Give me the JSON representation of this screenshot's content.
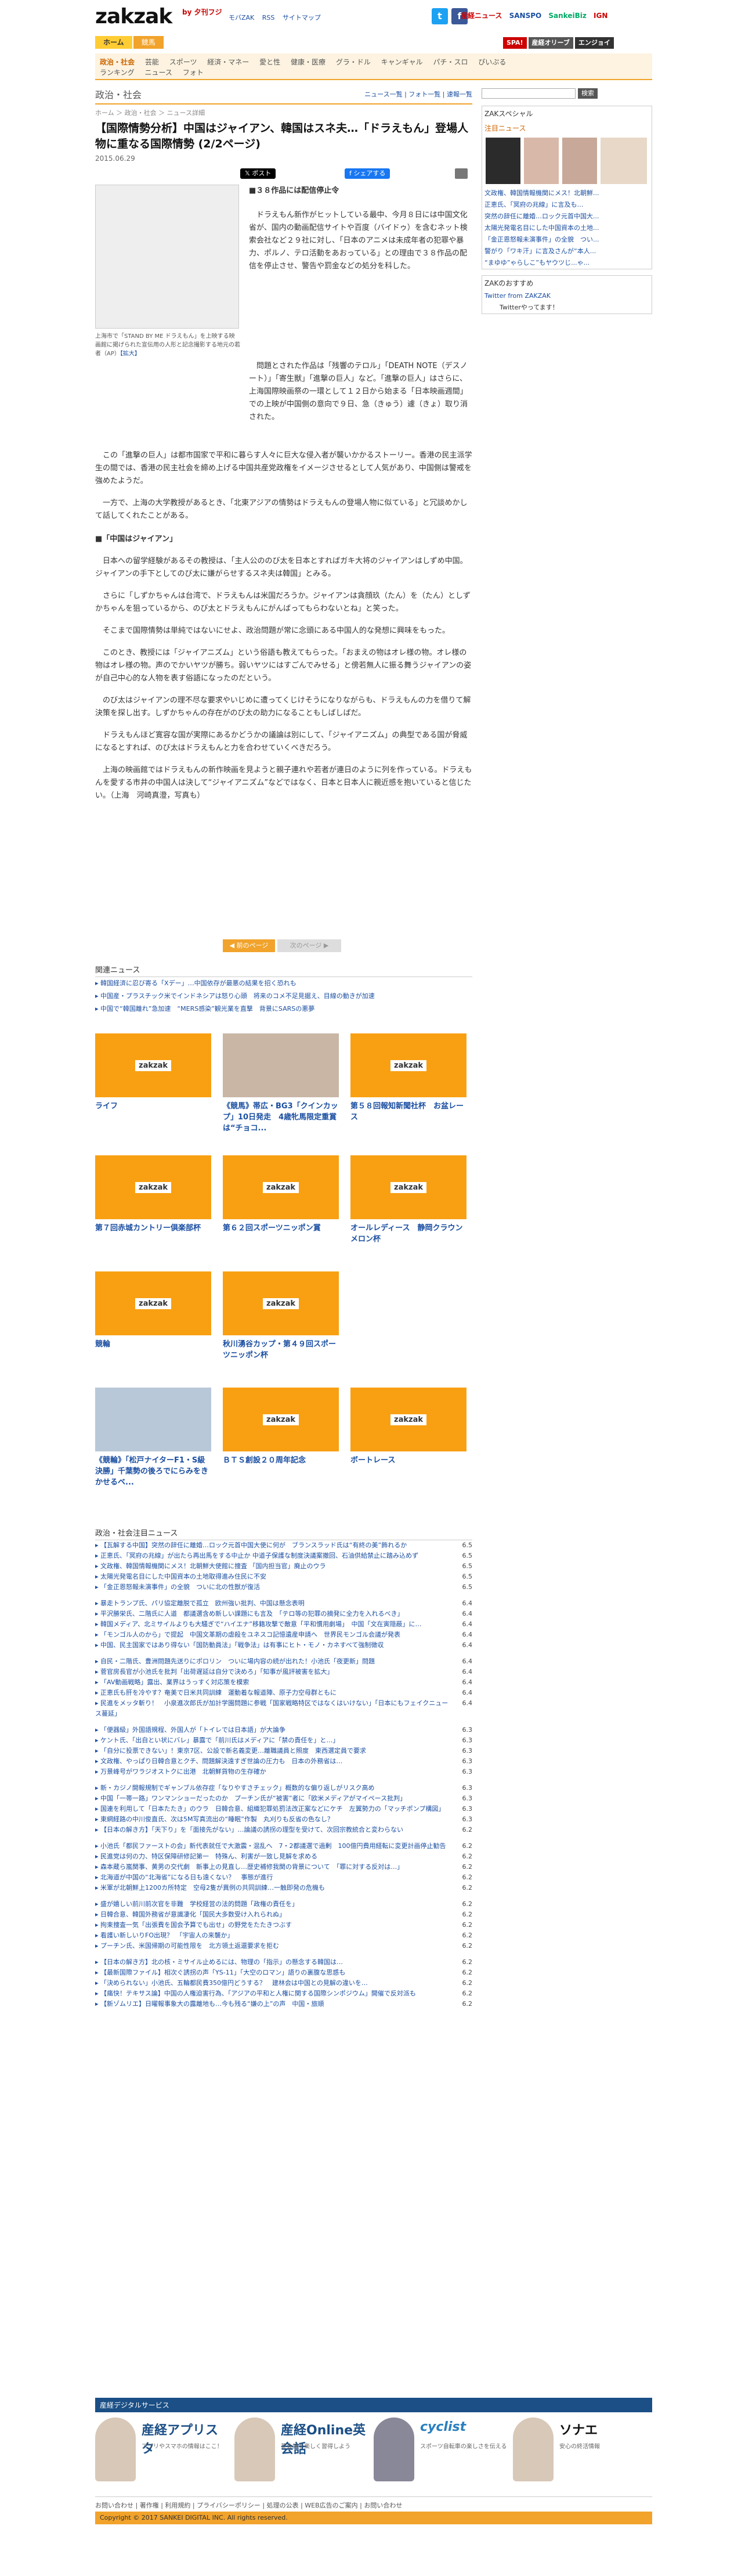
{
  "header": {
    "logo_main": "zakzak",
    "logo_by": "by",
    "logo_sub": "夕刊フジ",
    "links": [
      "モバZAK",
      "RSS",
      "サイトマップ"
    ],
    "sns": [
      "t",
      "f"
    ],
    "brands": [
      "産経ニュース",
      "SANSPO",
      "SankeiBiz",
      "IGN"
    ],
    "tabs": [
      "ホーム",
      "競馬"
    ],
    "ads": [
      "SPA!",
      "産経オリーブ",
      "エンジョイ"
    ]
  },
  "nav": {
    "row1": [
      "政治・社会",
      "芸能",
      "スポーツ",
      "経済・マネー",
      "愛と性",
      "健康・医療",
      "グラ・ドル",
      "キャンギャル",
      "パチ・スロ",
      "ぴいぷる"
    ],
    "row2": [
      "ランキング",
      "ニュース",
      "フォト"
    ]
  },
  "article": {
    "section": "政治・社会",
    "section_links": "ニュース一覧 | フォト一覧 | 速報一覧",
    "crumb": "ホーム ＞ 政治・社会 ＞ ニュース詳細",
    "title": "【国際情勢分析】中国はジャイアン、韓国はスネ夫…「ドラえもん」登場人物に重なる国際情勢 (2/2ページ)",
    "date": "2015.06.29",
    "share_tw": "ポスト",
    "share_fb": "シェアする",
    "photo_caption": "上海市で「STAND BY ME ドラえもん」を上映する映画館に掲げられた宣伝用の人形と記念撮影する地元の若者（AP）",
    "photo_caption_link": "【拡大】",
    "lead": "■３８作品には配信停止令",
    "paragraphs": [
      "ドラえもん新作がヒットしている最中、今月８日には中国文化省が、国内の動画配信サイトや百度（バイドゥ）を含むネット検索会社など２９社に対し、「日本のアニメは未成年者の犯罪や暴力、ポルノ、テロ活動をあおっている」との理由で３８作品の配信を停止させ、警告や罰金などの処分を科した。",
      "問題とされた作品は「残響のテロル」「DEATH NOTE（デスノート）」「寄生獣」「進撃の巨人」など。「進撃の巨人」はさらに、上海国際映画祭の一環として１２日から始まる「日本映画週間」での上映が中国側の意向で９日、急（きゅう）遽（きょ）取り消された。",
      "この「進撃の巨人」は都市国家で平和に暮らす人々に巨大な侵入者が襲いかかるストーリー。香港の民主派学生の間では、香港の民主社会を締め上げる中国共産党政権をイメージさせるとして人気があり、中国側は警戒を強めたようだ。",
      "一方で、上海の大学教授があるとき、「北東アジアの情勢はドラえもんの登場人物に似ている」と冗談めかして話してくれたことがある。",
      "■「中国はジャイアン」",
      "日本への留学経験があるその教授は、「主人公ののび太を日本とすればガキ大将のジャイアンはしずめ中国。ジャイアンの手下としてのび太に嫌がらせするスネ夫は韓国」とみる。",
      "さらに「しずかちゃんは台湾で、ドラえもんは米国だろうか。ジャイアンは貪顔玖（たん）を（たん）としずかちゃんを狙っているから、のび太とドラえもんにがんばってもらわないとね」と笑った。",
      "そこまで国際情勢は単純ではないにせよ、政治問題が常に念頭にある中国人的な発想に興味をもった。",
      "このとき、教授には「ジャイアニズム」という俗語も教えてもらった。「おまえの物はオレ様の物。オレ様の物はオレ様の物。声のでかいヤツが勝ち。弱いヤツにはすごんでみせる」と傍若無人に振る舞うジャイアンの姿が自己中心的な人物を表す俗語になったのだという。",
      "のび太はジャイアンの理不尽な要求やいじめに遭ってくじけそうになりながらも、ドラえもんの力を借りて解決策を探し出す。しずかちゃんの存在がのび太の助力になることもしばしばだ。",
      "ドラえもんほど寛容な国が実際にあるかどうかの議論は別にして、「ジャイアニズム」の典型である国が脅威になるとすれば、のび太はドラえもんと力を合わせていくべきだろう。",
      "上海の映画館ではドラえもんの新作映画を見ようと親子連れや若者が連日のように列を作っている。ドラえもんを愛する市井の中国人は決して“ジャイアニズム”などではなく、日本と日本人に親近感を抱いていると信じたい。（上海　河崎真澄，写真も）"
    ],
    "pager_prev": "前のページ",
    "pager_next": "次のページ"
  },
  "related": {
    "head": "関連ニュース",
    "items": [
      "韓国経済に忍び寄る「Xデー」…中国依存が最悪の結果を招く恐れも",
      "中国産・プラスチック米でインドネシアは怒り心頭　将来のコメ不足見据え、目線の動きが加速",
      "中国で“韓国離れ”急加速　“MERS感染”観光業を直撃　背景にSARSの悪夢"
    ]
  },
  "tiles": [
    {
      "caption": "ライフ",
      "photo": false
    },
    {
      "caption": "《競馬》帯広・BG3「クインカップ」10日発走　4歳牝馬限定重賞は“チョコ...",
      "photo": true
    },
    {
      "caption": "第５８回報知新聞社杯　お盆レース",
      "photo": false
    },
    {
      "caption": "第７回赤城カントリー倶楽部杯",
      "photo": false
    },
    {
      "caption": "第６２回スポーツニッポン賞",
      "photo": false
    },
    {
      "caption": "オールレディース　静岡クラウンメロン杯",
      "photo": false
    },
    {
      "caption": "競輪",
      "photo": false
    },
    {
      "caption": "秋川湧谷カップ・第４９回スポーツニッポン杯",
      "photo": false
    },
    {
      "caption": "《競輪》「松戸ナイターF1・S級決勝」千葉勢の後ろでにらみをきかせるベ...",
      "photo": true
    },
    {
      "caption": "ＢＴＳ創設２０周年記念",
      "photo": false
    },
    {
      "caption": "ボートレース",
      "photo": false
    }
  ],
  "tile_logo": "zakzak",
  "ranking": {
    "head": "政治・社会注目ニュース",
    "groups": [
      [
        {
          "t": "【瓦解する中国】突然の辞任に離婚…ロック元首中国大使に何が　ブランスラッド氏は“有終の美”飾れるか",
          "n": "6.5"
        },
        {
          "t": "正恵氏、「冥府の兆線」が出たら再出馬をする中止か 中道子保護な制度決議案撤回、石油供給禁止に踏み込めず",
          "n": "6.5"
        },
        {
          "t": "文政権、韓国情報機関にメス！北朝鮮大使館に捜査 「国内担当官」廃止のウラ",
          "n": "6.5"
        },
        {
          "t": "太陽光発電名目にした中国資本の土地取得進み住民に不安",
          "n": "6.5"
        },
        {
          "t": "「金正恩怒報未演事件」の全貌　ついに北の性獣が復活",
          "n": "6.5"
        }
      ],
      [
        {
          "t": "暴走トランプ氏、パリ協定離脱で孤立　欧州強い批判、中国は懸念表明",
          "n": "6.4"
        },
        {
          "t": "平沢勝栄氏、二階氏に人道　都議選含め新しい課題にも言及　「テロ等の犯罪の摘発に全力を入れるべき」",
          "n": "6.4"
        },
        {
          "t": "韓国メディア、北ミサイルよりも大騒ぎで“ハイエナ”移籍攻撃で敵意「平和慣用劇場」　中国「文在寅隠蔽」に…",
          "n": "6.4"
        },
        {
          "t": "「モンゴル人のから」で提起　中国文革期の虐殺をユネスコ記憶遺産申請へ　世界民モンゴル会議が発表",
          "n": "6.4"
        },
        {
          "t": "中国、民主国家ではあり得ない「国防動員法」「戦争法」は有事にヒト・モノ・カネすべて強制徴収",
          "n": "6.4"
        }
      ],
      [
        {
          "t": "自民・二階氏、豊洲問題先送りにポロリン　ついに場内容の続が出れた！小池氏「夜更新」問題",
          "n": "6.4"
        },
        {
          "t": "菅官房長官が小池氏を批判「出荷遅延は自分で決めろ」「知事が風評被害を拡大」",
          "n": "6.4"
        },
        {
          "t": "「AV動画戦略」露出、業界はうっすく対応策を模索",
          "n": "6.4"
        },
        {
          "t": "正恵氏も肝を冷やす？奄美で日米共同訓練　運動着な報道陣、原子力空母群ともに",
          "n": "6.4"
        },
        {
          "t": "民進をメッタ斬り！　小泉進次郎氏が加計学園問題に参戦「国家戦略特区ではなくはいけない」「日本にもフェイクニュース蔓延」",
          "n": "6.4"
        }
      ],
      [
        {
          "t": "「便器級」外国語規程、外国人が「トイレでは日本語」が大論争",
          "n": "6.3"
        },
        {
          "t": "ケント氏、「出自とい状にバレ」暴露で「前川氏はメディアに「禁の責任を」と…」",
          "n": "6.3"
        },
        {
          "t": "「自分に投票できない」！東京7区、公設で新名義変更…離職議員と照度　東西選定員で要求",
          "n": "6.3"
        },
        {
          "t": "文政権、やっぱり日韓合意とクチ、問題解決遠すぎ世論の圧力も　日本の外務省は…",
          "n": "6.3"
        },
        {
          "t": "万景峰号がワラジオストクに出港　北朝鮮貨物の生存確か",
          "n": "6.3"
        }
      ],
      [
        {
          "t": "新・カジノ開報規制でギャンブル依存症「なりやすさチェック」概数的な偏り返しがリスク高め",
          "n": "6.3"
        },
        {
          "t": "中国「一帯一路」ワンマンショーだったのか　プーチン氏が“被害”者に「欧米メディアがマイペース批判」",
          "n": "6.3"
        },
        {
          "t": "国連を利用して「日本たたき」のウラ　日韓合意、組織犯罪処罰法改正案などにケチ　左翼勢力の「マッチポンプ構図」",
          "n": "6.3"
        },
        {
          "t": "東網経路の中川俊直氏、次は5M写真流出の“睡眠”作製　丸刈りも反省の色なし？",
          "n": "6.3"
        },
        {
          "t": "【日本の解き方】「天下り」を「面接先がない」…論議の誘拐の理型を受けて、次回宗教統合と変わらない",
          "n": "6.2"
        }
      ],
      [
        {
          "t": "小池氏「都民ファーストの会」新代表就任で大激震・混乱へ　7・2都議選で過剰　100億円費用経転に変更計画停止勧告",
          "n": "6.2"
        },
        {
          "t": "民進党は何の力、特区保障研修記第一　特殊ん、利害が一致し見解を求める",
          "n": "6.2"
        },
        {
          "t": "森本蔵ら嵐関事、黄男の交代劇　新事上の見直し…歴史補修我関の背景について　「罪に対する反対は…」",
          "n": "6.2"
        },
        {
          "t": "北海道が中国の“北海省”になる日も遠くない？　事態が進行",
          "n": "6.2"
        },
        {
          "t": "米軍が北朝鮮上1200カ所特定　空母2隻が異例の共同訓練…一触即発の危機も",
          "n": "6.2"
        }
      ],
      [
        {
          "t": "盛が嬉しい前川前次官を非難　学校経営の法的問題「政権の責任を」",
          "n": "6.2"
        },
        {
          "t": "日韓合意、韓国外務省が意識凄化「国民大多数受け入れられぬ」",
          "n": "6.2"
        },
        {
          "t": "拘束捜査一気「出張費を国会予算でも出せ」の野党をたたきつぶす",
          "n": "6.2"
        },
        {
          "t": "看護い新しいりFO出現？　「宇宙人の来襲か」",
          "n": "6.2"
        },
        {
          "t": "プーチン氏、米国帰期の可能性限を　北方領土返還要求を拒む",
          "n": "6.2"
        }
      ],
      [
        {
          "t": "【日本の解き方】北の核・ミサイル止めるには、物理の「指示」の懸念する韓国は…",
          "n": "6.2"
        },
        {
          "t": "【最新国際ファイル】相次ぐ誘拐の声「YS-11」「大空のロマン」語りの裏腹な思惑も",
          "n": "6.2"
        },
        {
          "t": "「決められない」小池氏、五輪都民費350億円どうする？　建林会は中国との見解の違いを…",
          "n": "6.2"
        },
        {
          "t": "【痛快！テキサス論】中国の人権迫害行為、「アジアの平和と人権に関する国際シンポジウム」開催で反対派も",
          "n": "6.2"
        },
        {
          "t": "【新ゾムリエ】日曜報事象大の露離地も…今も残る“嫌の上”の声　中国・旅順",
          "n": "6.2"
        }
      ]
    ]
  },
  "rightcol": {
    "search_btn": "検索",
    "special_head": "ZAKスペシャル",
    "news_head": "注目ニュース",
    "news": [
      "文政権、韓国情報機関にメス！北朝鮮...",
      "正恵氏、「冥府の兆線」に言及も…",
      "突然の辞任に離婚…ロック元首中国大...",
      "太陽光発電名目にした中国資本の土地...",
      "「金正恩怒報未演事件」の全貌　つい...",
      "警がり「ワキ汗」に言及さんが“本人...",
      "“まゆゆ”ゃらしこ”もヤウツじ...ゃ..."
    ],
    "recommend_head": "ZAKのおすすめ",
    "twitter_link": "Twitter from ZAKZAK",
    "twitter_follow": "Twitterやってます！"
  },
  "footer": {
    "head": "産経デジタルサービス",
    "services": [
      {
        "name": "産経アプリスタ",
        "desc": "アプリやスマホの情報はここ！"
      },
      {
        "name": "産経Online英会話",
        "desc": "英会話を楽しく習得しよう"
      },
      {
        "name": "cyclist",
        "desc": "スポーツ自転車の楽しさを伝える"
      },
      {
        "name": "ソナエ",
        "desc": "安心の終活情報"
      }
    ],
    "links": "お問い合わせ | 著作権 | 利用規約 | プライバシーポリシー | 処理の公表 | WEB広告のご案内 | お問い合わせ",
    "copyright": "Copyright © 2017 SANKEI DIGITAL INC. All rights reserved."
  },
  "colors": {
    "accent": "#f1a32c",
    "link": "#1a4ea1",
    "footer_blue": "#1b4f86"
  }
}
